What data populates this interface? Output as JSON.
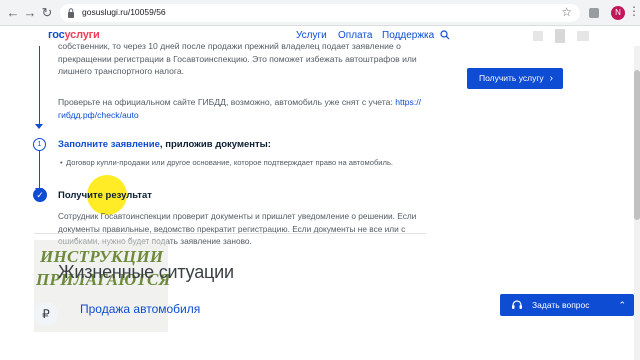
{
  "browser": {
    "url": "gosuslugi.ru/10059/56",
    "profile_initial": "N"
  },
  "header": {
    "logo_part1": "гос",
    "logo_part2": "услуги",
    "nav": [
      "Услуги",
      "Оплата",
      "Поддержка"
    ]
  },
  "intro": {
    "para1": "собственник, то через 10 дней после продажи прежний владелец подает заявление о прекращении регистрации в Госавтоинспекцию. Это поможет избежать автоштрафов или лишнего транспортного налога.",
    "para2_text": "Проверьте на официальном сайте ГИБДД, возможно, автомобиль уже снят с учета:",
    "para2_link": "https://гибдд.рф/check/auto"
  },
  "steps": [
    {
      "number": "1",
      "title_link": "Заполните заявление",
      "title_rest": ", приложив документы:",
      "bullets": [
        "Договор купли-продажи или другое основание, которое подтверждает право на автомобиль."
      ]
    },
    {
      "title": "Получите результат",
      "text": "Сотрудник Госавтоинспекции проверит документы и пришлет уведомление о решении. Если документы правильные, ведомство прекратит регистрацию. Если документы не все или с ошибками, нужно будет подать заявление заново."
    }
  ],
  "cta": {
    "label": "Получить услугу"
  },
  "watermark": {
    "line1": "ИНСТРУКЦИИ",
    "line2": "ПРИЛАГАЮТСЯ"
  },
  "section": {
    "heading": "Жизненные ситуации"
  },
  "card": {
    "title": "Продажа автомобиля",
    "icon": "₽"
  },
  "chat": {
    "label": "Задать вопрос"
  },
  "colors": {
    "brand_blue": "#0d4cd3",
    "brand_red": "#ee3f58",
    "highlight": "#ffe900"
  }
}
